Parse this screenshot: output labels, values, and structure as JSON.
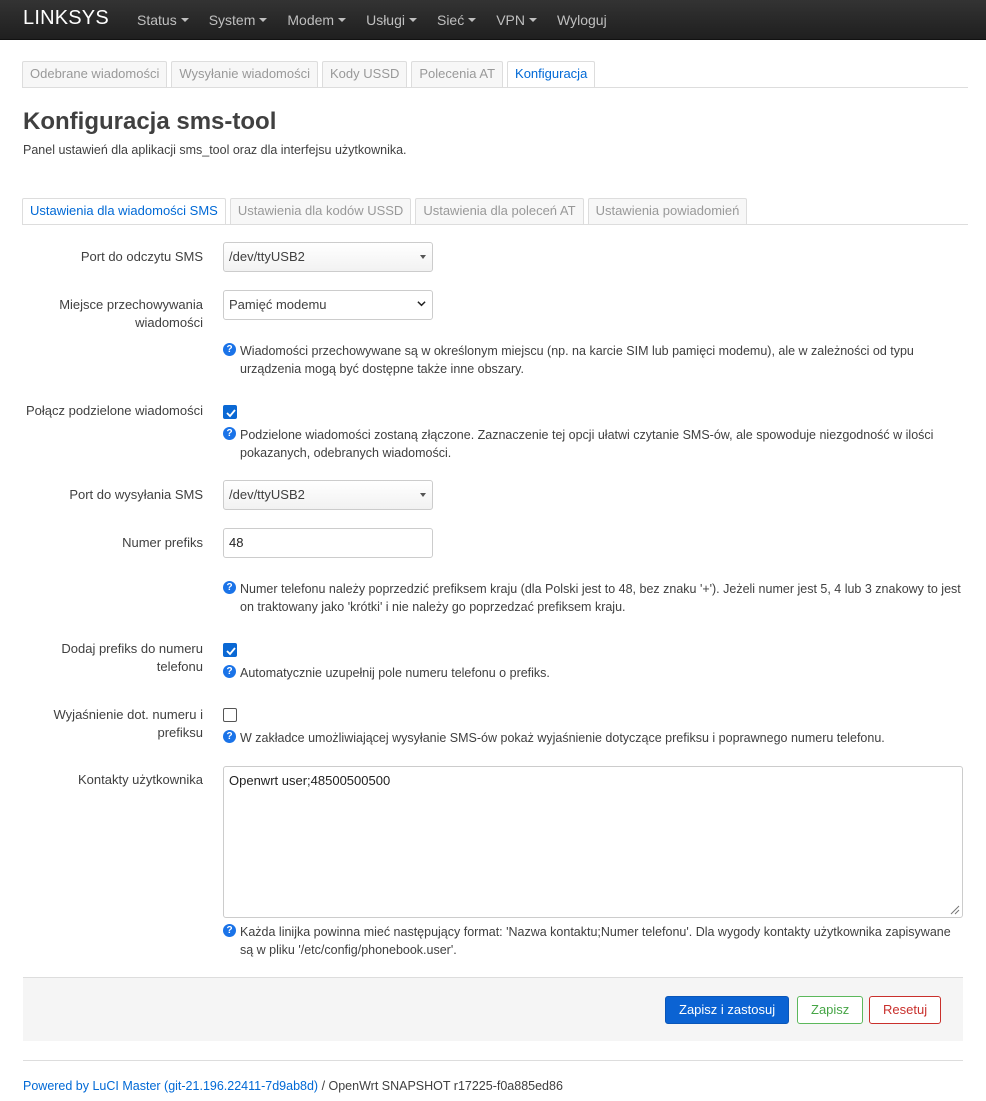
{
  "navbar": {
    "brand": "LINKSYS",
    "menu": [
      {
        "label": "Status",
        "dropdown": true
      },
      {
        "label": "System",
        "dropdown": true
      },
      {
        "label": "Modem",
        "dropdown": true
      },
      {
        "label": "Usługi",
        "dropdown": true
      },
      {
        "label": "Sieć",
        "dropdown": true
      },
      {
        "label": "VPN",
        "dropdown": true
      },
      {
        "label": "Wyloguj",
        "dropdown": false
      }
    ]
  },
  "main_tabs": [
    {
      "label": "Odebrane wiadomości",
      "active": false
    },
    {
      "label": "Wysyłanie wiadomości",
      "active": false
    },
    {
      "label": "Kody USSD",
      "active": false
    },
    {
      "label": "Polecenia AT",
      "active": false
    },
    {
      "label": "Konfiguracja",
      "active": true
    }
  ],
  "page": {
    "title": "Konfiguracja sms-tool",
    "description": "Panel ustawień dla aplikacji sms_tool oraz dla interfejsu użytkownika."
  },
  "sub_tabs": [
    {
      "label": "Ustawienia dla wiadomości SMS",
      "active": true
    },
    {
      "label": "Ustawienia dla kodów USSD",
      "active": false
    },
    {
      "label": "Ustawienia dla poleceń AT",
      "active": false
    },
    {
      "label": "Ustawienia powiadomień",
      "active": false
    }
  ],
  "form": {
    "read_port": {
      "label": "Port do odczytu SMS",
      "value": "/dev/ttyUSB2"
    },
    "storage": {
      "label": "Miejsce przechowywania wiadomości",
      "value": "Pamięć modemu",
      "help": "Wiadomości przechowywane są w określonym miejscu (np. na karcie SIM lub pamięci modemu), ale w zależności od typu urządzenia mogą być dostępne także inne obszary."
    },
    "merge": {
      "label": "Połącz podzielone wiadomości",
      "checked": true,
      "help": "Podzielone wiadomości zostaną złączone. Zaznaczenie tej opcji ułatwi czytanie SMS-ów, ale spowoduje niezgodność w ilości pokazanych, odebranych wiadomości."
    },
    "send_port": {
      "label": "Port do wysyłania SMS",
      "value": "/dev/ttyUSB2"
    },
    "prefix": {
      "label": "Numer prefiks",
      "value": "48",
      "help": "Numer telefonu należy poprzedzić prefiksem kraju (dla Polski jest to 48, bez znaku '+'). Jeżeli numer jest 5, 4 lub 3 znakowy to jest on traktowany jako 'krótki' i nie należy go poprzedzać prefiksem kraju."
    },
    "add_prefix": {
      "label": "Dodaj prefiks do numeru telefonu",
      "checked": true,
      "help": "Automatycznie uzupełnij pole numeru telefonu o prefiks."
    },
    "explain": {
      "label": "Wyjaśnienie dot. numeru i prefiksu",
      "checked": false,
      "help": "W zakładce umożliwiającej wysyłanie SMS-ów pokaż wyjaśnienie dotyczące prefiksu i poprawnego numeru telefonu."
    },
    "contacts": {
      "label": "Kontakty użytkownika",
      "value": "Openwrt user;48500500500",
      "help": "Każda linijka powinna mieć następujący format: 'Nazwa kontaktu;Numer telefonu'. Dla wygody kontakty użytkownika zapisywane są w pliku '/etc/config/phonebook.user'."
    }
  },
  "actions": {
    "save_apply": "Zapisz i zastosuj",
    "save": "Zapisz",
    "reset": "Resetuj"
  },
  "footer": {
    "link": "Powered by LuCI Master (git-21.196.22411-7d9ab8d)",
    "rest": " / OpenWrt SNAPSHOT r17225-f0a885ed86"
  },
  "colors": {
    "accent": "#0069d6",
    "navbar": "#222222",
    "apply_button": "#0b63d3",
    "save_button": "#46a546",
    "reset_button": "#c9302c"
  },
  "icons": [
    "help-icon",
    "checkmark-icon",
    "chevron-down-icon",
    "caret-down-icon",
    "resize-grip-icon"
  ]
}
